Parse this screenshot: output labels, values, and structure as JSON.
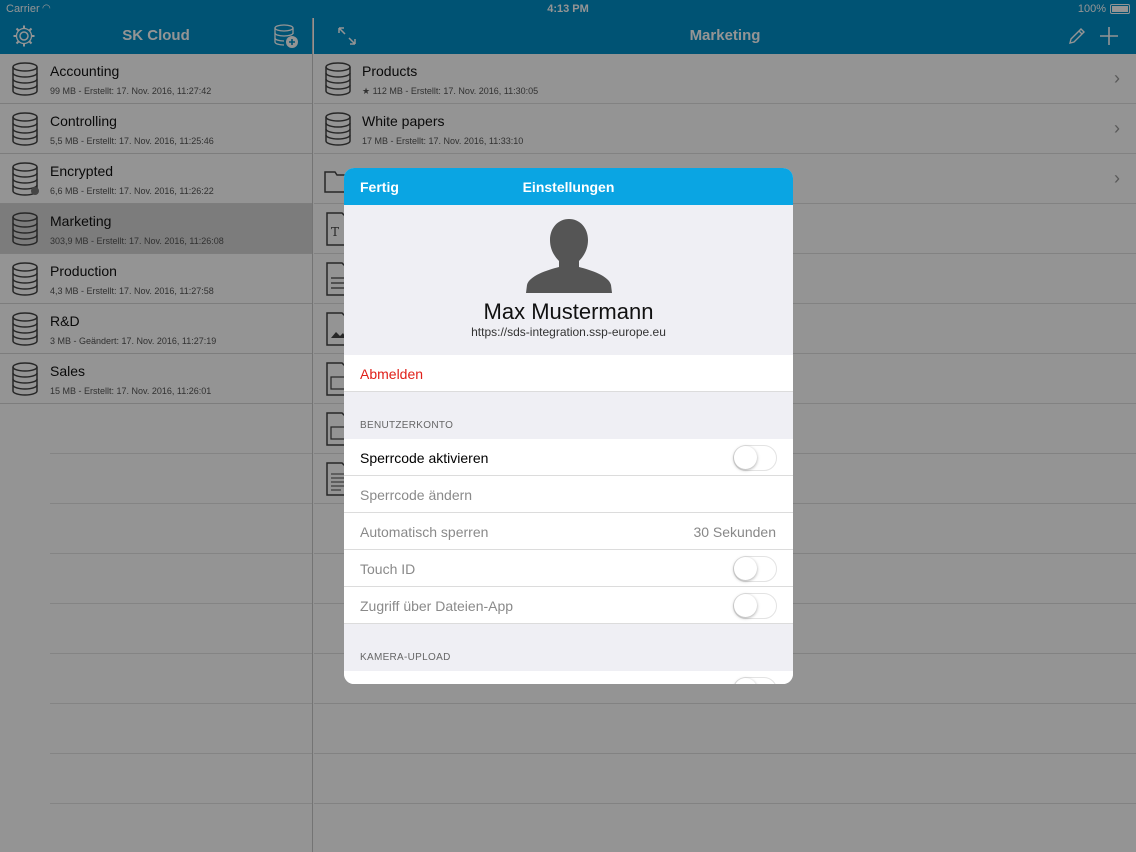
{
  "status": {
    "carrier": "Carrier",
    "time": "4:13 PM",
    "battery": "100%"
  },
  "left": {
    "title": "SK Cloud",
    "rooms": [
      {
        "name": "Accounting",
        "meta": "99 MB - Erstellt: 17. Nov. 2016, 11:27:42"
      },
      {
        "name": "Controlling",
        "meta": "5,5 MB - Erstellt: 17. Nov. 2016, 11:25:46"
      },
      {
        "name": "Encrypted",
        "meta": "6,6 MB - Erstellt: 17. Nov. 2016, 11:26:22"
      },
      {
        "name": "Marketing",
        "meta": "303,9 MB - Erstellt: 17. Nov. 2016, 11:26:08"
      },
      {
        "name": "Production",
        "meta": "4,3 MB - Erstellt: 17. Nov. 2016, 11:27:58"
      },
      {
        "name": "R&D",
        "meta": "3 MB - Geändert: 17. Nov. 2016, 11:27:19"
      },
      {
        "name": "Sales",
        "meta": "15 MB - Erstellt: 17. Nov. 2016, 11:26:01"
      }
    ]
  },
  "right": {
    "title": "Marketing",
    "items": [
      {
        "name": "Products",
        "meta": "★ 112 MB - Erstellt: 17. Nov. 2016, 11:30:05"
      },
      {
        "name": "White papers",
        "meta": "17 MB - Erstellt: 17. Nov. 2016, 11:33:10"
      }
    ]
  },
  "modal": {
    "done_label": "Fertig",
    "title": "Einstellungen",
    "user_name": "Max Mustermann",
    "server_url": "https://sds-integration.ssp-europe.eu",
    "signout_label": "Abmelden",
    "section_account": "BENUTZERKONTO",
    "passcode_enable": "Sperrcode aktivieren",
    "passcode_change": "Sperrcode ändern",
    "auto_lock": "Automatisch sperren",
    "auto_lock_value": "30 Sekunden",
    "touch_id": "Touch ID",
    "files_app": "Zugriff über Dateien-App",
    "section_camera": "KAMERA-UPLOAD"
  }
}
